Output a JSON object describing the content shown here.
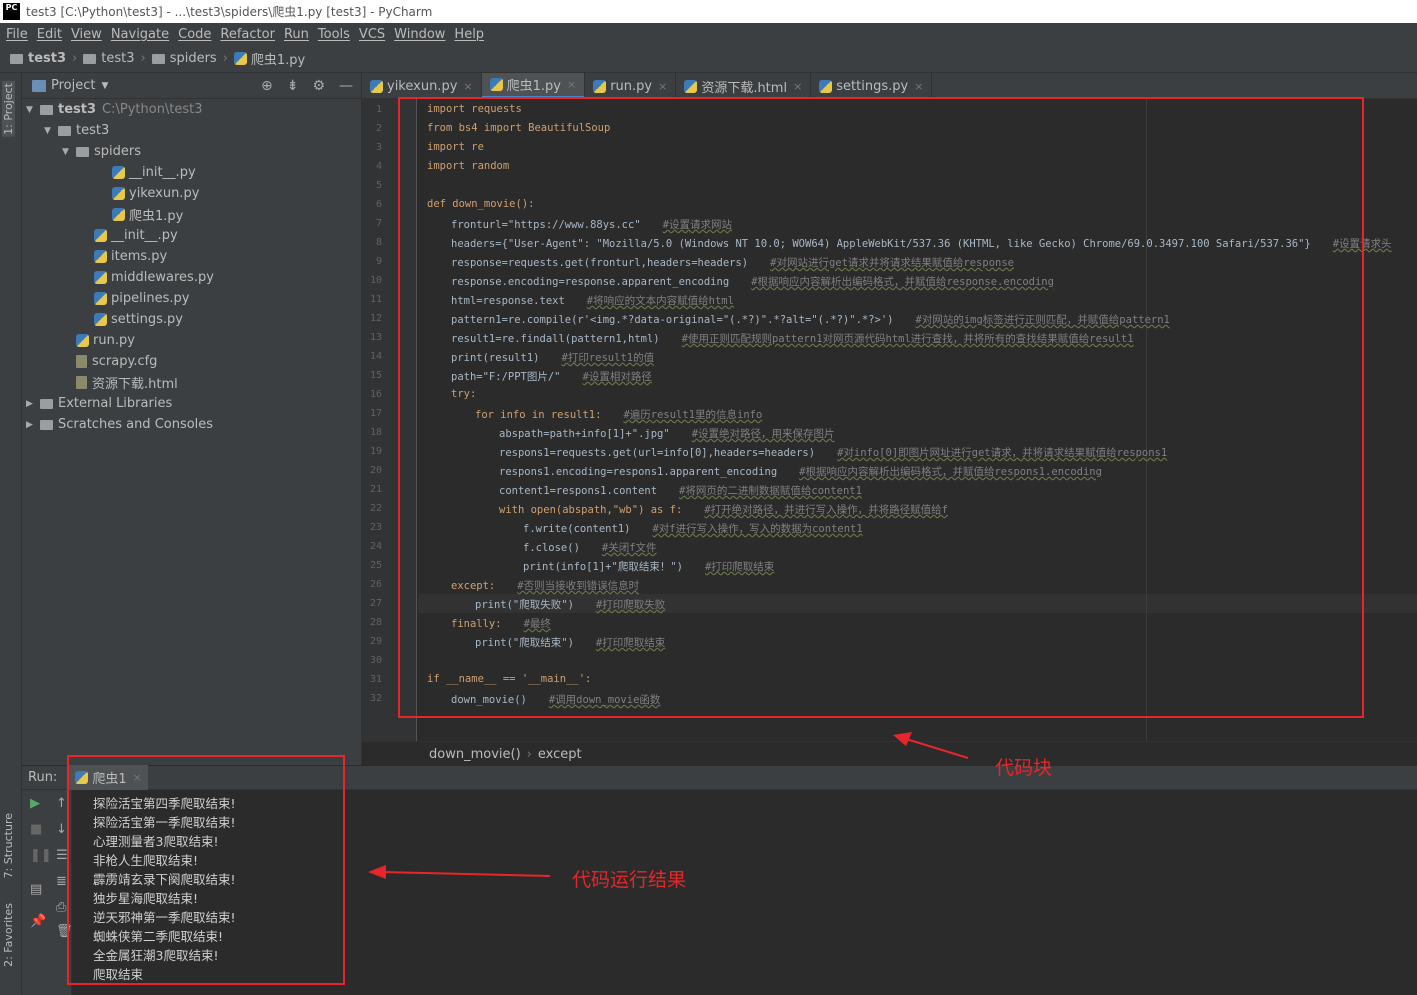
{
  "window": {
    "title": "test3 [C:\\Python\\test3] - ...\\test3\\spiders\\爬虫1.py [test3] - PyCharm",
    "logo": "PC"
  },
  "menu": [
    "File",
    "Edit",
    "View",
    "Navigate",
    "Code",
    "Refactor",
    "Run",
    "Tools",
    "VCS",
    "Window",
    "Help"
  ],
  "breadcrumb": [
    "test3",
    "test3",
    "spiders",
    "爬虫1.py"
  ],
  "side_tabs": {
    "project": "1: Project",
    "structure": "7: Structure",
    "favorites": "2: Favorites"
  },
  "project": {
    "header": "Project",
    "tree": [
      {
        "label": "test3",
        "extra": "C:\\Python\\test3",
        "depth": 0,
        "type": "folder",
        "expanded": true,
        "bold": true
      },
      {
        "label": "test3",
        "depth": 1,
        "type": "folder",
        "expanded": true
      },
      {
        "label": "spiders",
        "depth": 2,
        "type": "folder",
        "expanded": true
      },
      {
        "label": "__init__.py",
        "depth": 4,
        "type": "py"
      },
      {
        "label": "yikexun.py",
        "depth": 4,
        "type": "py"
      },
      {
        "label": "爬虫1.py",
        "depth": 4,
        "type": "py"
      },
      {
        "label": "__init__.py",
        "depth": 3,
        "type": "py"
      },
      {
        "label": "items.py",
        "depth": 3,
        "type": "py"
      },
      {
        "label": "middlewares.py",
        "depth": 3,
        "type": "py"
      },
      {
        "label": "pipelines.py",
        "depth": 3,
        "type": "py"
      },
      {
        "label": "settings.py",
        "depth": 3,
        "type": "py"
      },
      {
        "label": "run.py",
        "depth": 2,
        "type": "py"
      },
      {
        "label": "scrapy.cfg",
        "depth": 2,
        "type": "file"
      },
      {
        "label": "资源下载.html",
        "depth": 2,
        "type": "file"
      },
      {
        "label": "External Libraries",
        "depth": 0,
        "type": "lib",
        "expanded": false
      },
      {
        "label": "Scratches and Consoles",
        "depth": 0,
        "type": "lib",
        "expanded": false
      }
    ]
  },
  "tabs": [
    {
      "label": "yikexun.py",
      "active": false
    },
    {
      "label": "爬虫1.py",
      "active": true
    },
    {
      "label": "run.py",
      "active": false
    },
    {
      "label": "资源下载.html",
      "active": false
    },
    {
      "label": "settings.py",
      "active": false
    }
  ],
  "code": [
    {
      "n": "1",
      "i": 0,
      "c": "import requests",
      "m": ""
    },
    {
      "n": "2",
      "i": 0,
      "c": "from bs4 import BeautifulSoup",
      "m": ""
    },
    {
      "n": "3",
      "i": 0,
      "c": "import re",
      "m": ""
    },
    {
      "n": "4",
      "i": 0,
      "c": "import random",
      "m": ""
    },
    {
      "n": "5",
      "i": 0,
      "c": "",
      "m": ""
    },
    {
      "n": "6",
      "i": 0,
      "c": "def down_movie():",
      "m": ""
    },
    {
      "n": "7",
      "i": 1,
      "c": "fronturl=\"https://www.88ys.cc\"",
      "m": "#设置请求网站"
    },
    {
      "n": "8",
      "i": 1,
      "c": "headers={\"User-Agent\": \"Mozilla/5.0 (Windows NT 10.0; WOW64) AppleWebKit/537.36 (KHTML, like Gecko) Chrome/69.0.3497.100 Safari/537.36\"}",
      "m": "#设置请求头"
    },
    {
      "n": "9",
      "i": 1,
      "c": "response=requests.get(fronturl,headers=headers)",
      "m": "#对网站进行get请求并将请求结果赋值给response"
    },
    {
      "n": "10",
      "i": 1,
      "c": "response.encoding=response.apparent_encoding",
      "m": "#根据响应内容解析出编码格式，并赋值给response.encoding"
    },
    {
      "n": "11",
      "i": 1,
      "c": "html=response.text",
      "m": "#将响应的文本内容赋值给html"
    },
    {
      "n": "12",
      "i": 1,
      "c": "pattern1=re.compile(r'<img.*?data-original=\"(.*?)\".*?alt=\"(.*?)\".*?>')",
      "m": "#对网站的img标签进行正则匹配，并赋值给pattern1"
    },
    {
      "n": "13",
      "i": 1,
      "c": "result1=re.findall(pattern1,html)",
      "m": "#使用正则匹配规则pattern1对网页源代码html进行查找，并将所有的查找结果赋值给result1"
    },
    {
      "n": "14",
      "i": 1,
      "c": "print(result1)",
      "m": "#打印result1的值"
    },
    {
      "n": "15",
      "i": 1,
      "c": "path=\"F:/PPT图片/\"",
      "m": "#设置相对路径"
    },
    {
      "n": "16",
      "i": 1,
      "c": "try:",
      "m": ""
    },
    {
      "n": "17",
      "i": 2,
      "c": "for info in result1:",
      "m": "#遍历result1里的信息info"
    },
    {
      "n": "18",
      "i": 3,
      "c": "abspath=path+info[1]+\".jpg\"",
      "m": "#设置绝对路径，用来保存图片"
    },
    {
      "n": "19",
      "i": 3,
      "c": "respons1=requests.get(url=info[0],headers=headers)",
      "m": "#对info[0]即图片网址进行get请求，并将请求结果赋值给respons1"
    },
    {
      "n": "20",
      "i": 3,
      "c": "respons1.encoding=respons1.apparent_encoding",
      "m": "#根据响应内容解析出编码格式，并赋值给respons1.encoding"
    },
    {
      "n": "21",
      "i": 3,
      "c": "content1=respons1.content",
      "m": "#将网页的二进制数据赋值给content1"
    },
    {
      "n": "22",
      "i": 3,
      "c": "with open(abspath,\"wb\") as f:",
      "m": "#打开绝对路径，并进行写入操作，并将路径赋值给f"
    },
    {
      "n": "23",
      "i": 4,
      "c": "f.write(content1)",
      "m": "#对f进行写入操作，写入的数据为content1"
    },
    {
      "n": "24",
      "i": 4,
      "c": "f.close()",
      "m": "#关闭f文件"
    },
    {
      "n": "25",
      "i": 4,
      "c": "print(info[1]+\"爬取结束！\")",
      "m": "#打印爬取结束"
    },
    {
      "n": "26",
      "i": 1,
      "c": "except:",
      "m": "#否则当接收到错误信息时"
    },
    {
      "n": "27",
      "i": 2,
      "c": "print(\"爬取失败\")",
      "m": "#打印爬取失败"
    },
    {
      "n": "28",
      "i": 1,
      "c": "finally:",
      "m": "#最终"
    },
    {
      "n": "29",
      "i": 2,
      "c": "print(\"爬取结束\")",
      "m": "#打印爬取结束"
    },
    {
      "n": "30",
      "i": 0,
      "c": "",
      "m": ""
    },
    {
      "n": "31",
      "i": 0,
      "c": "if __name__ == '__main__':",
      "m": ""
    },
    {
      "n": "32",
      "i": 1,
      "c": "down_movie()",
      "m": "#调用down_movie函数"
    }
  ],
  "current_line": "27",
  "editor_breadcrumb": [
    "down_movie()",
    "except"
  ],
  "run": {
    "label": "Run:",
    "tab": "爬虫1",
    "output": [
      "探险活宝第四季爬取结束!",
      "探险活宝第一季爬取结束!",
      "心理测量者3爬取结束!",
      "非枪人生爬取结束!",
      "霹雳靖玄录下阕爬取结束!",
      "独步星海爬取结束!",
      "逆天邪神第一季爬取结束!",
      "蜘蛛侠第二季爬取结束!",
      "全金属狂潮3爬取结束!",
      "爬取结束"
    ]
  },
  "annotations": {
    "code_block": "代码块",
    "run_result": "代码运行结果"
  },
  "colors": {
    "accent": "#e8262a",
    "keyword": "#cc7832",
    "string": "#6a8759"
  }
}
